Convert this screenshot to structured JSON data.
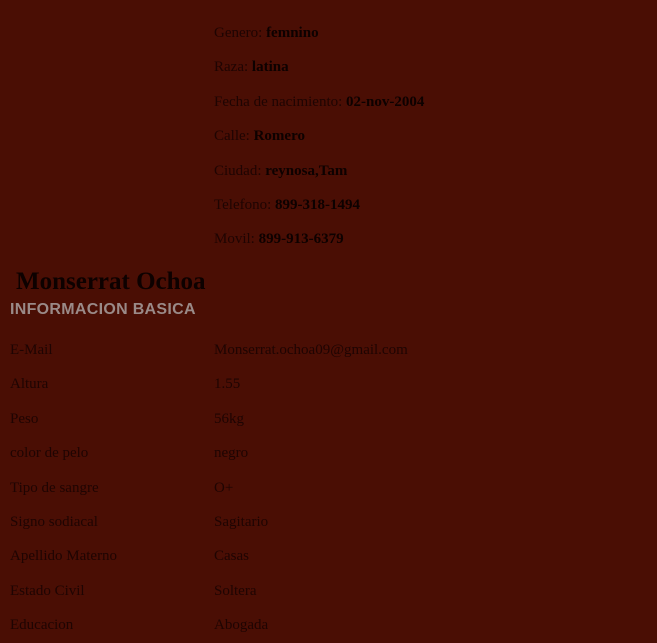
{
  "top_info": [
    {
      "label": "Genero: ",
      "value": "femnino"
    },
    {
      "label": "Raza: ",
      "value": "latina"
    },
    {
      "label": "Fecha de nacimiento: ",
      "value": "02-nov-2004"
    },
    {
      "label": "Calle: ",
      "value": "Romero"
    },
    {
      "label": "Ciudad: ",
      "value": "reynosa,Tam"
    },
    {
      "label": "Telefono: ",
      "value": "899-318-1494"
    },
    {
      "label": "Movil: ",
      "value": "899-913-6379"
    }
  ],
  "profile": {
    "name": "Monserrat Ochoa",
    "section_title": "INFORMACION BASICA"
  },
  "basic_info": [
    {
      "label": "E-Mail",
      "value": "Monserrat.ochoa09@gmail.com"
    },
    {
      "label": "Altura",
      "value": "1.55"
    },
    {
      "label": "Peso",
      "value": "56kg"
    },
    {
      "label": "color de pelo",
      "value": "negro"
    },
    {
      "label": "Tipo de sangre",
      "value": "O+"
    },
    {
      "label": "Signo sodiacal",
      "value": "Sagitario"
    },
    {
      "label": "Apellido Materno",
      "value": "Casas"
    },
    {
      "label": "Estado Civil",
      "value": "Soltera"
    },
    {
      "label": "Educacion",
      "value": "Abogada"
    }
  ],
  "colors": {
    "background": "#4a0e04",
    "text": "#1e0402",
    "heading": "#9a8a88"
  }
}
